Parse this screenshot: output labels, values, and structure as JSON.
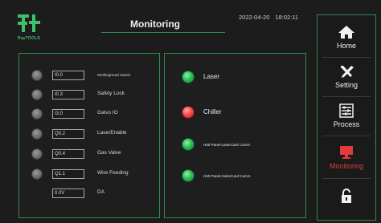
{
  "brand": {
    "name": "RayTOOLS"
  },
  "header": {
    "title": "Monitoring",
    "date": "2022-04-20",
    "time": "18:02:11"
  },
  "io_list": [
    {
      "address": "I0.0",
      "label": "WeldingHead Switch"
    },
    {
      "address": "I0.3",
      "label": "Safety Lock"
    },
    {
      "address": "I3.0",
      "label": "Galvo IO"
    },
    {
      "address": "Q0.2",
      "label": "LaserEnable"
    },
    {
      "address": "Q0.4",
      "label": "Gas Valve"
    },
    {
      "address": "Q1.1",
      "label": "Wire Feeding"
    },
    {
      "address": "0.0V",
      "label": "DA"
    }
  ],
  "status_list": [
    {
      "label": "Laser",
      "state": "green"
    },
    {
      "label": "Chiller",
      "state": "red"
    },
    {
      "label": "HMI Panel-LaserCard Comm",
      "state": "green"
    },
    {
      "label": "HMI Panel-GalvoCard Comm",
      "state": "green"
    }
  ],
  "sidebar": {
    "items": [
      {
        "label": "Home",
        "icon": "home-icon"
      },
      {
        "label": "Setting",
        "icon": "tools-icon"
      },
      {
        "label": "Process",
        "icon": "sliders-icon"
      },
      {
        "label": "Monitoring",
        "icon": "monitor-icon"
      },
      {
        "label": "",
        "icon": "lock-icon"
      }
    ],
    "active": "Monitoring"
  },
  "colors": {
    "accent_green": "#2e8a4f",
    "lamp_on_green": "#2fbf5a",
    "lamp_alarm_red": "#ff4a4a",
    "lamp_off_gray": "#6e6e6e",
    "active_nav_red": "#e23b3b",
    "logo_green": "#3fbf6a"
  }
}
